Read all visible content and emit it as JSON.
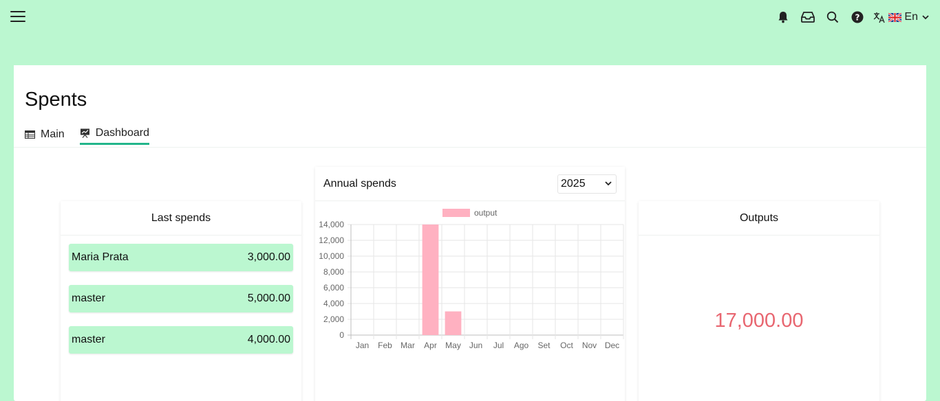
{
  "topbar": {
    "icons": [
      "menu-icon",
      "bell-icon",
      "inbox-icon",
      "search-icon",
      "help-icon",
      "translate-icon"
    ],
    "language": {
      "flag": "uk-flag",
      "label": "En"
    }
  },
  "page": {
    "title": "Spents",
    "tabs": [
      {
        "label": "Main",
        "icon": "table-icon",
        "active": false
      },
      {
        "label": "Dashboard",
        "icon": "chart-icon",
        "active": true
      }
    ]
  },
  "last_spends": {
    "title": "Last spends",
    "items": [
      {
        "name": "Maria Prata",
        "amount": "3,000.00"
      },
      {
        "name": "master",
        "amount": "5,000.00"
      },
      {
        "name": "master",
        "amount": "4,000.00"
      }
    ]
  },
  "annual": {
    "title": "Annual spends",
    "year": "2025"
  },
  "outputs": {
    "title": "Outputs",
    "value": "17,000.00",
    "color": "#e86670"
  },
  "chart_data": {
    "type": "bar",
    "categories": [
      "Jan",
      "Feb",
      "Mar",
      "Apr",
      "May",
      "Jun",
      "Jul",
      "Ago",
      "Set",
      "Oct",
      "Nov",
      "Dec"
    ],
    "series": [
      {
        "name": "output",
        "values": [
          0,
          0,
          0,
          14000,
          3000,
          0,
          0,
          0,
          0,
          0,
          0,
          0
        ],
        "color": "#ffb1c1"
      }
    ],
    "ylim": [
      0,
      14000
    ],
    "yticks": [
      "14,000",
      "12,000",
      "10,000",
      "8,000",
      "6,000",
      "4,000",
      "2,000",
      "0"
    ],
    "grid": true,
    "legend": "top"
  }
}
